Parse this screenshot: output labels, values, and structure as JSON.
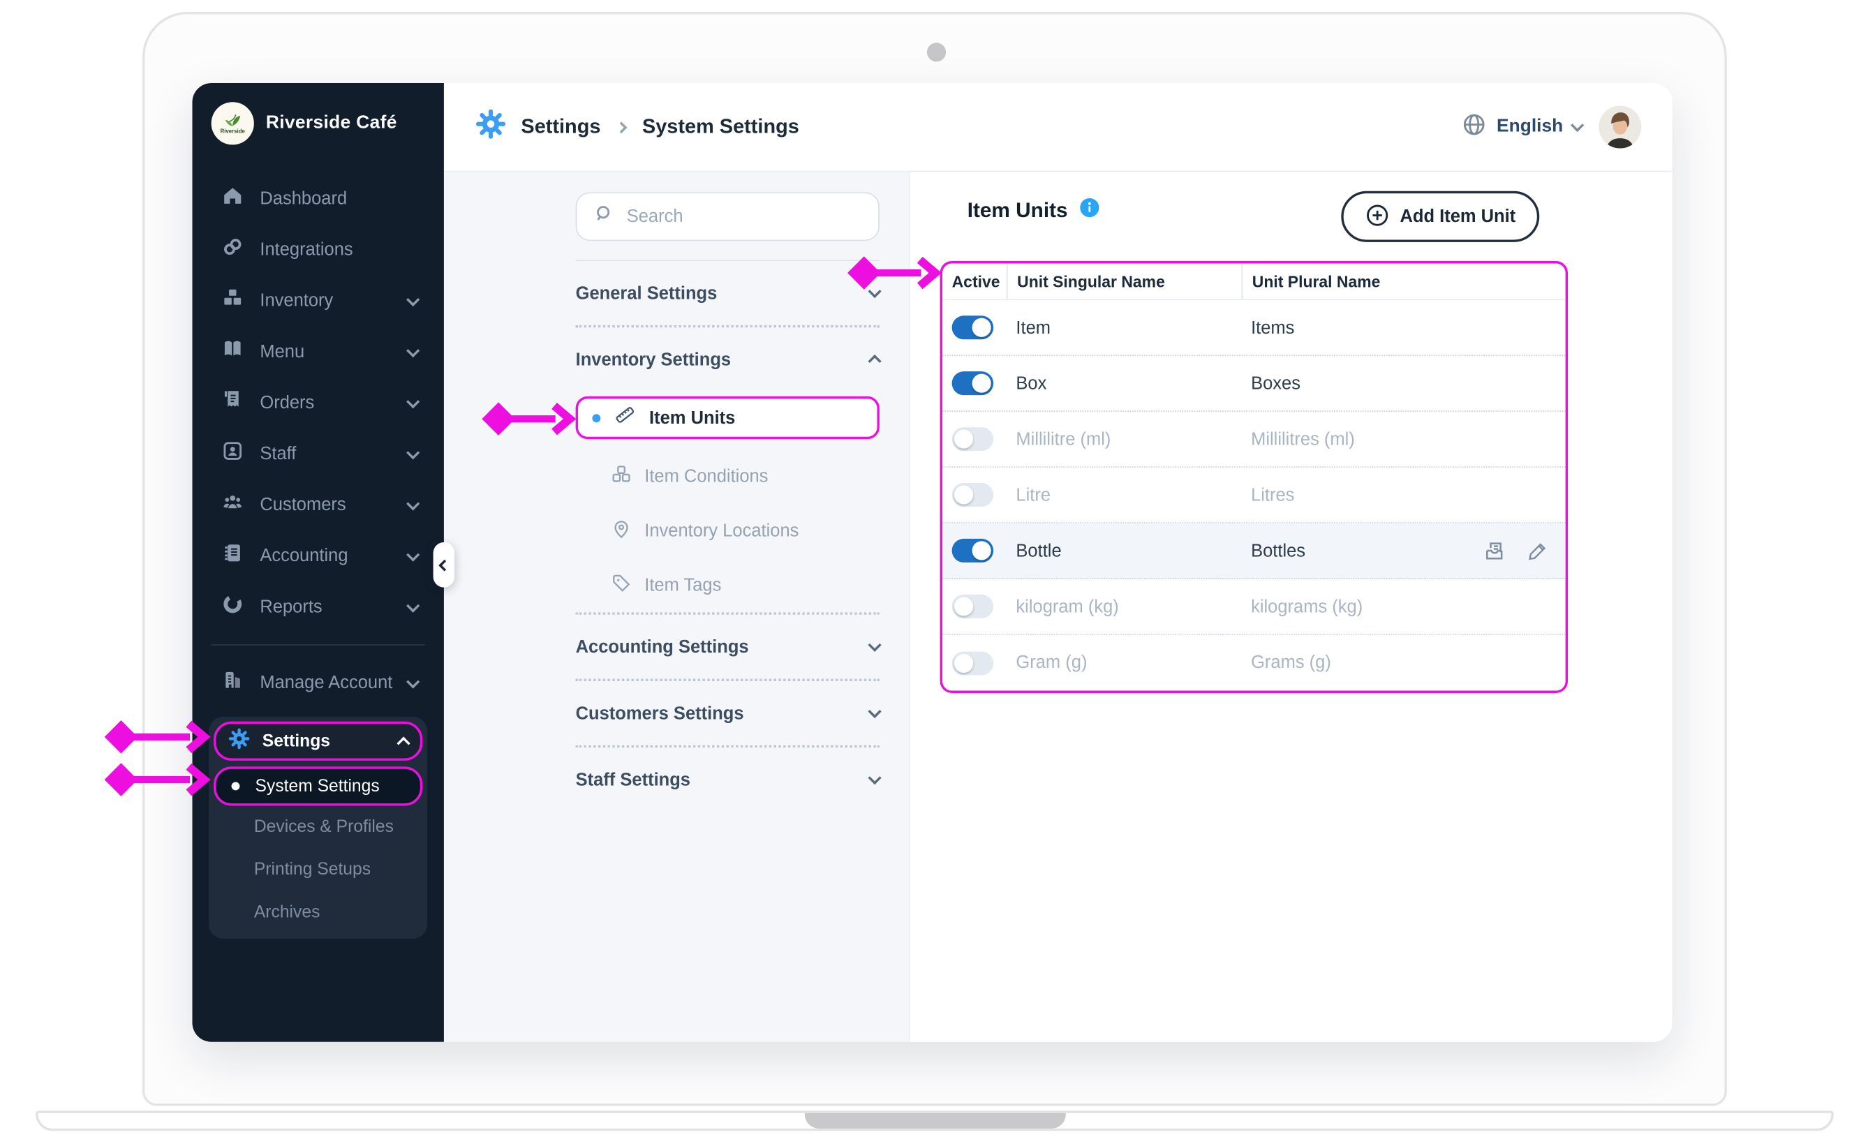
{
  "device": {
    "type": "laptop-mockup"
  },
  "colors": {
    "annotation_magenta": "#ED0FE0",
    "accent_blue": "#3D9DF3",
    "toggle_on_blue": "#1E70C2",
    "sidebar_bg": "#121D2B"
  },
  "sidebar": {
    "brand": "Riverside Café",
    "items": [
      {
        "label": "Dashboard",
        "chevron": false
      },
      {
        "label": "Integrations",
        "chevron": false
      },
      {
        "label": "Inventory",
        "chevron": true
      },
      {
        "label": "Menu",
        "chevron": true
      },
      {
        "label": "Orders",
        "chevron": true
      },
      {
        "label": "Staff",
        "chevron": true
      },
      {
        "label": "Customers",
        "chevron": true
      },
      {
        "label": "Accounting",
        "chevron": true
      },
      {
        "label": "Reports",
        "chevron": true
      }
    ],
    "manage_account": "Manage Account",
    "settings": {
      "label": "Settings",
      "active_item": "System Settings",
      "items": [
        "System Settings",
        "Devices & Profiles",
        "Printing Setups",
        "Archives"
      ]
    }
  },
  "header": {
    "breadcrumb_root": "Settings",
    "breadcrumb_current": "System Settings",
    "language": "English"
  },
  "settings_nav": {
    "search_placeholder": "Search",
    "general": "General Settings",
    "inventory": "Inventory Settings",
    "inventory_children": [
      {
        "label": "Item Units",
        "active": true
      },
      {
        "label": "Item Conditions",
        "active": false
      },
      {
        "label": "Inventory Locations",
        "active": false
      },
      {
        "label": "Item Tags",
        "active": false
      }
    ],
    "accounting": "Accounting Settings",
    "customers": "Customers Settings",
    "staff": "Staff Settings"
  },
  "main": {
    "title": "Item Units",
    "add_button": "Add Item Unit",
    "table": {
      "columns": [
        "Active",
        "Unit Singular Name",
        "Unit Plural Name"
      ],
      "rows": [
        {
          "active": true,
          "singular": "Item",
          "plural": "Items",
          "highlighted": false
        },
        {
          "active": true,
          "singular": "Box",
          "plural": "Boxes",
          "highlighted": false
        },
        {
          "active": false,
          "singular": "Millilitre (ml)",
          "plural": "Millilitres (ml)",
          "highlighted": false
        },
        {
          "active": false,
          "singular": "Litre",
          "plural": "Litres",
          "highlighted": false
        },
        {
          "active": true,
          "singular": "Bottle",
          "plural": "Bottles",
          "highlighted": true
        },
        {
          "active": false,
          "singular": "kilogram (kg)",
          "plural": "kilograms (kg)",
          "highlighted": false
        },
        {
          "active": false,
          "singular": "Gram (g)",
          "plural": "Grams (g)",
          "highlighted": false
        }
      ]
    }
  }
}
